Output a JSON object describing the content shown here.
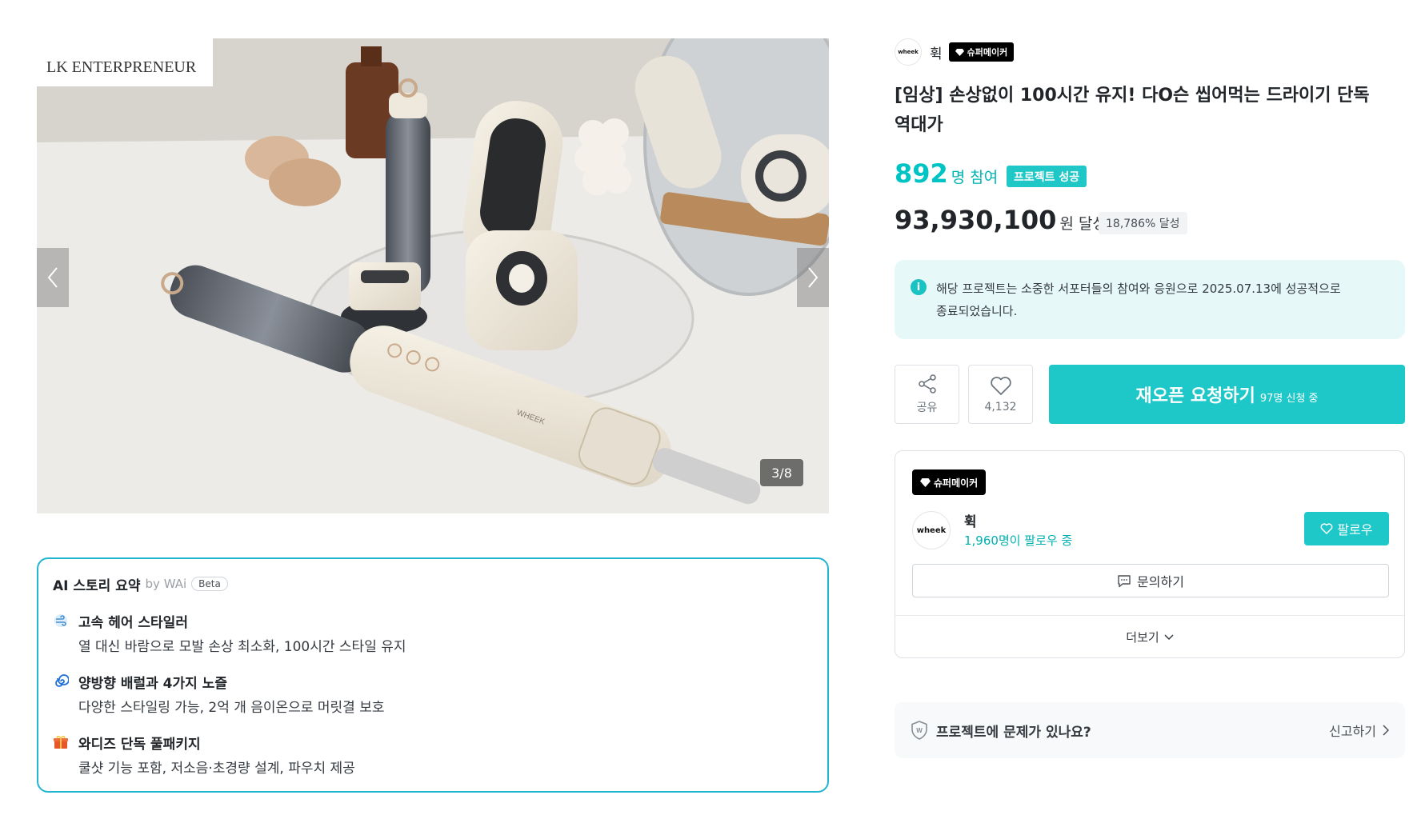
{
  "gallery": {
    "counter": "3/8",
    "prev_icon": "chevron-left-icon",
    "next_icon": "chevron-right-icon",
    "image_subject": "hair styler product photo",
    "photo_caption_text": "LK ENTERPRENEUR",
    "device_brand_text": "WHEEK"
  },
  "ai_summary": {
    "title": "AI 스토리 요약",
    "by": "by WAi",
    "badge": "Beta",
    "items": [
      {
        "icon": "wind-icon",
        "title": "고속 헤어 스타일러",
        "desc": "열 대신 바람으로 모발 손상 최소화, 100시간 스타일 유지"
      },
      {
        "icon": "swirl-icon",
        "title": "양방향 배럴과 4가지 노즐",
        "desc": "다양한 스타일링 가능, 2억 개 음이온으로 머릿결 보호"
      },
      {
        "icon": "gift-icon",
        "title": "와디즈 단독 풀패키지",
        "desc": "쿨샷 기능 포함, 저소음·초경량 설계, 파우치 제공"
      }
    ]
  },
  "maker": {
    "logo_text": "wheek",
    "name": "휙",
    "badge": "슈퍼메이커",
    "followers": "1,960명이 팔로우 중",
    "follow_label": "팔로우",
    "inquiry_label": "문의하기",
    "more_label": "더보기"
  },
  "project": {
    "title": "[임상] 손상없이 100시간 유지! 다O슨 씹어먹는 드라이기 단독 역대가",
    "participants": "892",
    "participants_unit": "명 참여",
    "status_badge": "프로젝트 성공",
    "amount": "93,930,100",
    "amount_unit": "원 달성",
    "rate": "18,786% 달성",
    "info": "해당 프로젝트는 소중한 서포터들의 참여와 응원으로 2025.07.13에 성공적으로 종료되었습니다."
  },
  "actions": {
    "share_label": "공유",
    "like_count": "4,132",
    "reopen_label": "재오픈 요청하기",
    "reopen_sub": "97명 신청 중"
  },
  "report": {
    "question": "프로젝트에 문제가 있나요?",
    "link": "신고하기"
  },
  "colors": {
    "accent": "#1fc8c8",
    "accent_text": "#00c4c4",
    "ai_border": "#22b5d0",
    "info_bg": "#e6f8f8"
  }
}
